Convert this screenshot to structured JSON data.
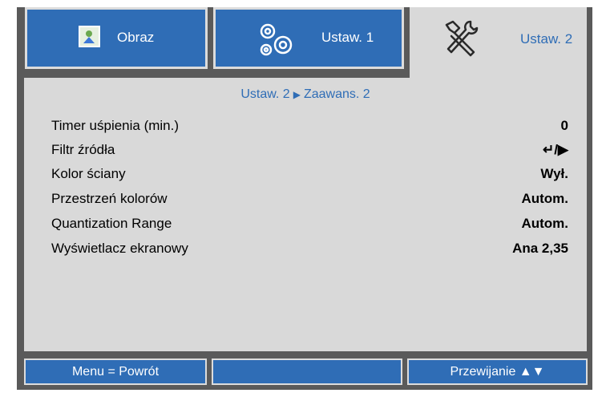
{
  "tabs": [
    {
      "label": "Obraz",
      "icon": "image-icon"
    },
    {
      "label": "Ustaw. 1",
      "icon": "gears-icon"
    },
    {
      "label": "Ustaw. 2",
      "icon": "tools-icon"
    }
  ],
  "breadcrumb": {
    "parent": "Ustaw. 2",
    "current": "Zaawans. 2"
  },
  "settings": [
    {
      "label": "Timer uśpienia (min.)",
      "value": "0"
    },
    {
      "label": "Filtr źródła",
      "value": "↵/▶"
    },
    {
      "label": "Kolor ściany",
      "value": "Wył."
    },
    {
      "label": "Przestrzeń kolorów",
      "value": "Autom."
    },
    {
      "label": "Quantization Range",
      "value": "Autom."
    },
    {
      "label": "Wyświetlacz ekranowy",
      "value": "Ana 2,35"
    }
  ],
  "footer": {
    "left": "Menu = Powrót",
    "middle": "",
    "right": "Przewijanie ▲▼"
  },
  "colors": {
    "accent": "#2f6db6",
    "panel": "#d9d9d9",
    "frame": "#5a5a5a"
  }
}
